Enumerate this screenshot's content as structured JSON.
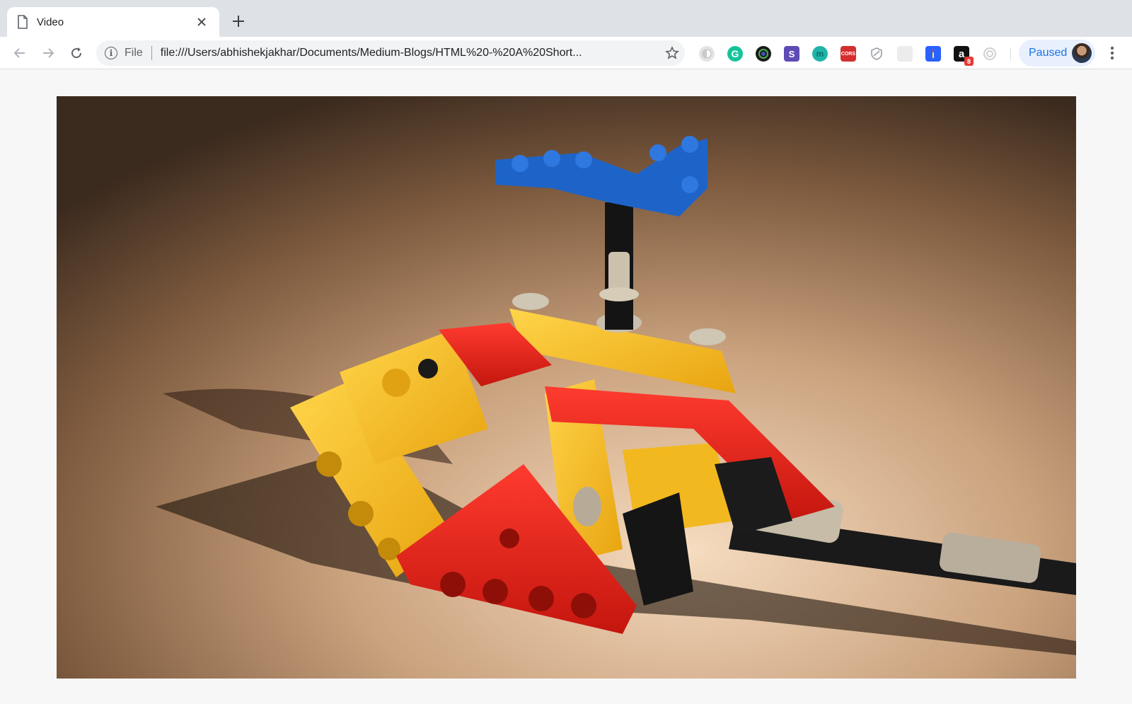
{
  "tab": {
    "title": "Video"
  },
  "omnibox": {
    "scheme_label": "File",
    "url": "file:///Users/abhishekjakhar/Documents/Medium-Blogs/HTML%20-%20A%20Short..."
  },
  "extensions": [
    {
      "name": "ghost-extension-icon",
      "label": "",
      "color": "#c9c9c9"
    },
    {
      "name": "grammarly-extension-icon",
      "label": "G",
      "color": "#15c39a"
    },
    {
      "name": "color-picker-extension-icon",
      "label": "",
      "color": "#1b1b1b"
    },
    {
      "name": "s-extension-icon",
      "label": "S",
      "color": "#5f4bb6"
    },
    {
      "name": "m-extension-icon",
      "label": "m",
      "color": "#1fb4a8"
    },
    {
      "name": "cors-extension-icon",
      "label": "CORS",
      "color": "#d32f2f"
    },
    {
      "name": "shield-extension-icon",
      "label": "",
      "color": "#9aa0a6"
    },
    {
      "name": "blank-extension-icon",
      "label": "",
      "color": "#e0e0e0"
    },
    {
      "name": "flag-extension-icon",
      "label": "",
      "color": "#2962ff"
    },
    {
      "name": "amazon-extension-icon",
      "label": "a",
      "color": "#111111",
      "badge": "8"
    },
    {
      "name": "target-extension-icon",
      "label": "",
      "color": "#d6d6d6"
    }
  ],
  "profile": {
    "label": "Paused"
  },
  "video": {
    "subject": "lego-technic-model"
  }
}
